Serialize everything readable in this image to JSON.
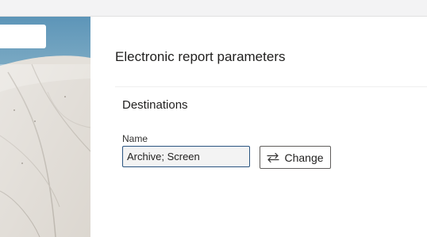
{
  "dialog": {
    "title": "Electronic report parameters"
  },
  "destinations": {
    "section_title": "Destinations",
    "name_label": "Name",
    "name_value": "Archive; Screen",
    "change_label": "Change",
    "change_icon": "swap-arrows-icon"
  }
}
